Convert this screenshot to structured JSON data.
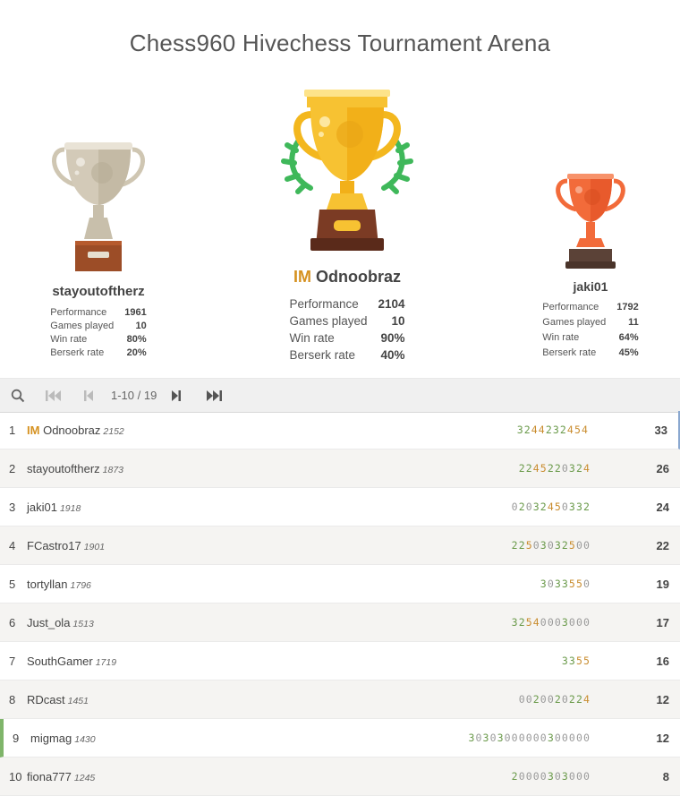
{
  "page": {
    "title": "Chess960 Hivechess Tournament Arena"
  },
  "colors": {
    "accent_title": "#d59120",
    "gold": "#f7c232",
    "silver": "#d3cab8",
    "bronze": "#f26b3a",
    "streak": "#c98c2e",
    "win": "#6a9a4a"
  },
  "podium": {
    "first": {
      "title": "IM",
      "name": "Odnoobraz",
      "stats": [
        {
          "label": "Performance",
          "value": "2104"
        },
        {
          "label": "Games played",
          "value": "10"
        },
        {
          "label": "Win rate",
          "value": "90%"
        },
        {
          "label": "Berserk rate",
          "value": "40%"
        }
      ]
    },
    "second": {
      "title": "",
      "name": "stayoutoftherz",
      "stats": [
        {
          "label": "Performance",
          "value": "1961"
        },
        {
          "label": "Games played",
          "value": "10"
        },
        {
          "label": "Win rate",
          "value": "80%"
        },
        {
          "label": "Berserk rate",
          "value": "20%"
        }
      ]
    },
    "third": {
      "title": "",
      "name": "jaki01",
      "stats": [
        {
          "label": "Performance",
          "value": "1792"
        },
        {
          "label": "Games played",
          "value": "11"
        },
        {
          "label": "Win rate",
          "value": "64%"
        },
        {
          "label": "Berserk rate",
          "value": "45%"
        }
      ]
    }
  },
  "pager": {
    "range": "1-10 / 19",
    "icons": [
      "search-icon",
      "first-page-icon",
      "previous-page-icon",
      "next-page-icon",
      "last-page-icon"
    ]
  },
  "standings": [
    {
      "rank": "1",
      "title": "IM",
      "name": "Odnoobraz",
      "rating": "2152",
      "sheet": "3244232454",
      "total": "33"
    },
    {
      "rank": "2",
      "title": "",
      "name": "stayoutoftherz",
      "rating": "1873",
      "sheet": "2245220324",
      "total": "26"
    },
    {
      "rank": "3",
      "title": "",
      "name": "jaki01",
      "rating": "1918",
      "sheet": "02032450332",
      "total": "24"
    },
    {
      "rank": "4",
      "title": "",
      "name": "FCastro17",
      "rating": "1901",
      "sheet": "22503032500",
      "total": "22"
    },
    {
      "rank": "5",
      "title": "",
      "name": "tortyllan",
      "rating": "1796",
      "sheet": "3033550",
      "total": "19"
    },
    {
      "rank": "6",
      "title": "",
      "name": "Just_ola",
      "rating": "1513",
      "sheet": "32540003000",
      "total": "17"
    },
    {
      "rank": "7",
      "title": "",
      "name": "SouthGamer",
      "rating": "1719",
      "sheet": "3355",
      "total": "16"
    },
    {
      "rank": "8",
      "title": "",
      "name": "RDcast",
      "rating": "1451",
      "sheet": "0020020224",
      "total": "12"
    },
    {
      "rank": "9",
      "title": "",
      "name": "migmag",
      "rating": "1430",
      "sheet": "30303000000300000",
      "total": "12"
    },
    {
      "rank": "10",
      "title": "",
      "name": "fiona777",
      "rating": "1245",
      "sheet": "20000303000",
      "total": "8"
    }
  ]
}
